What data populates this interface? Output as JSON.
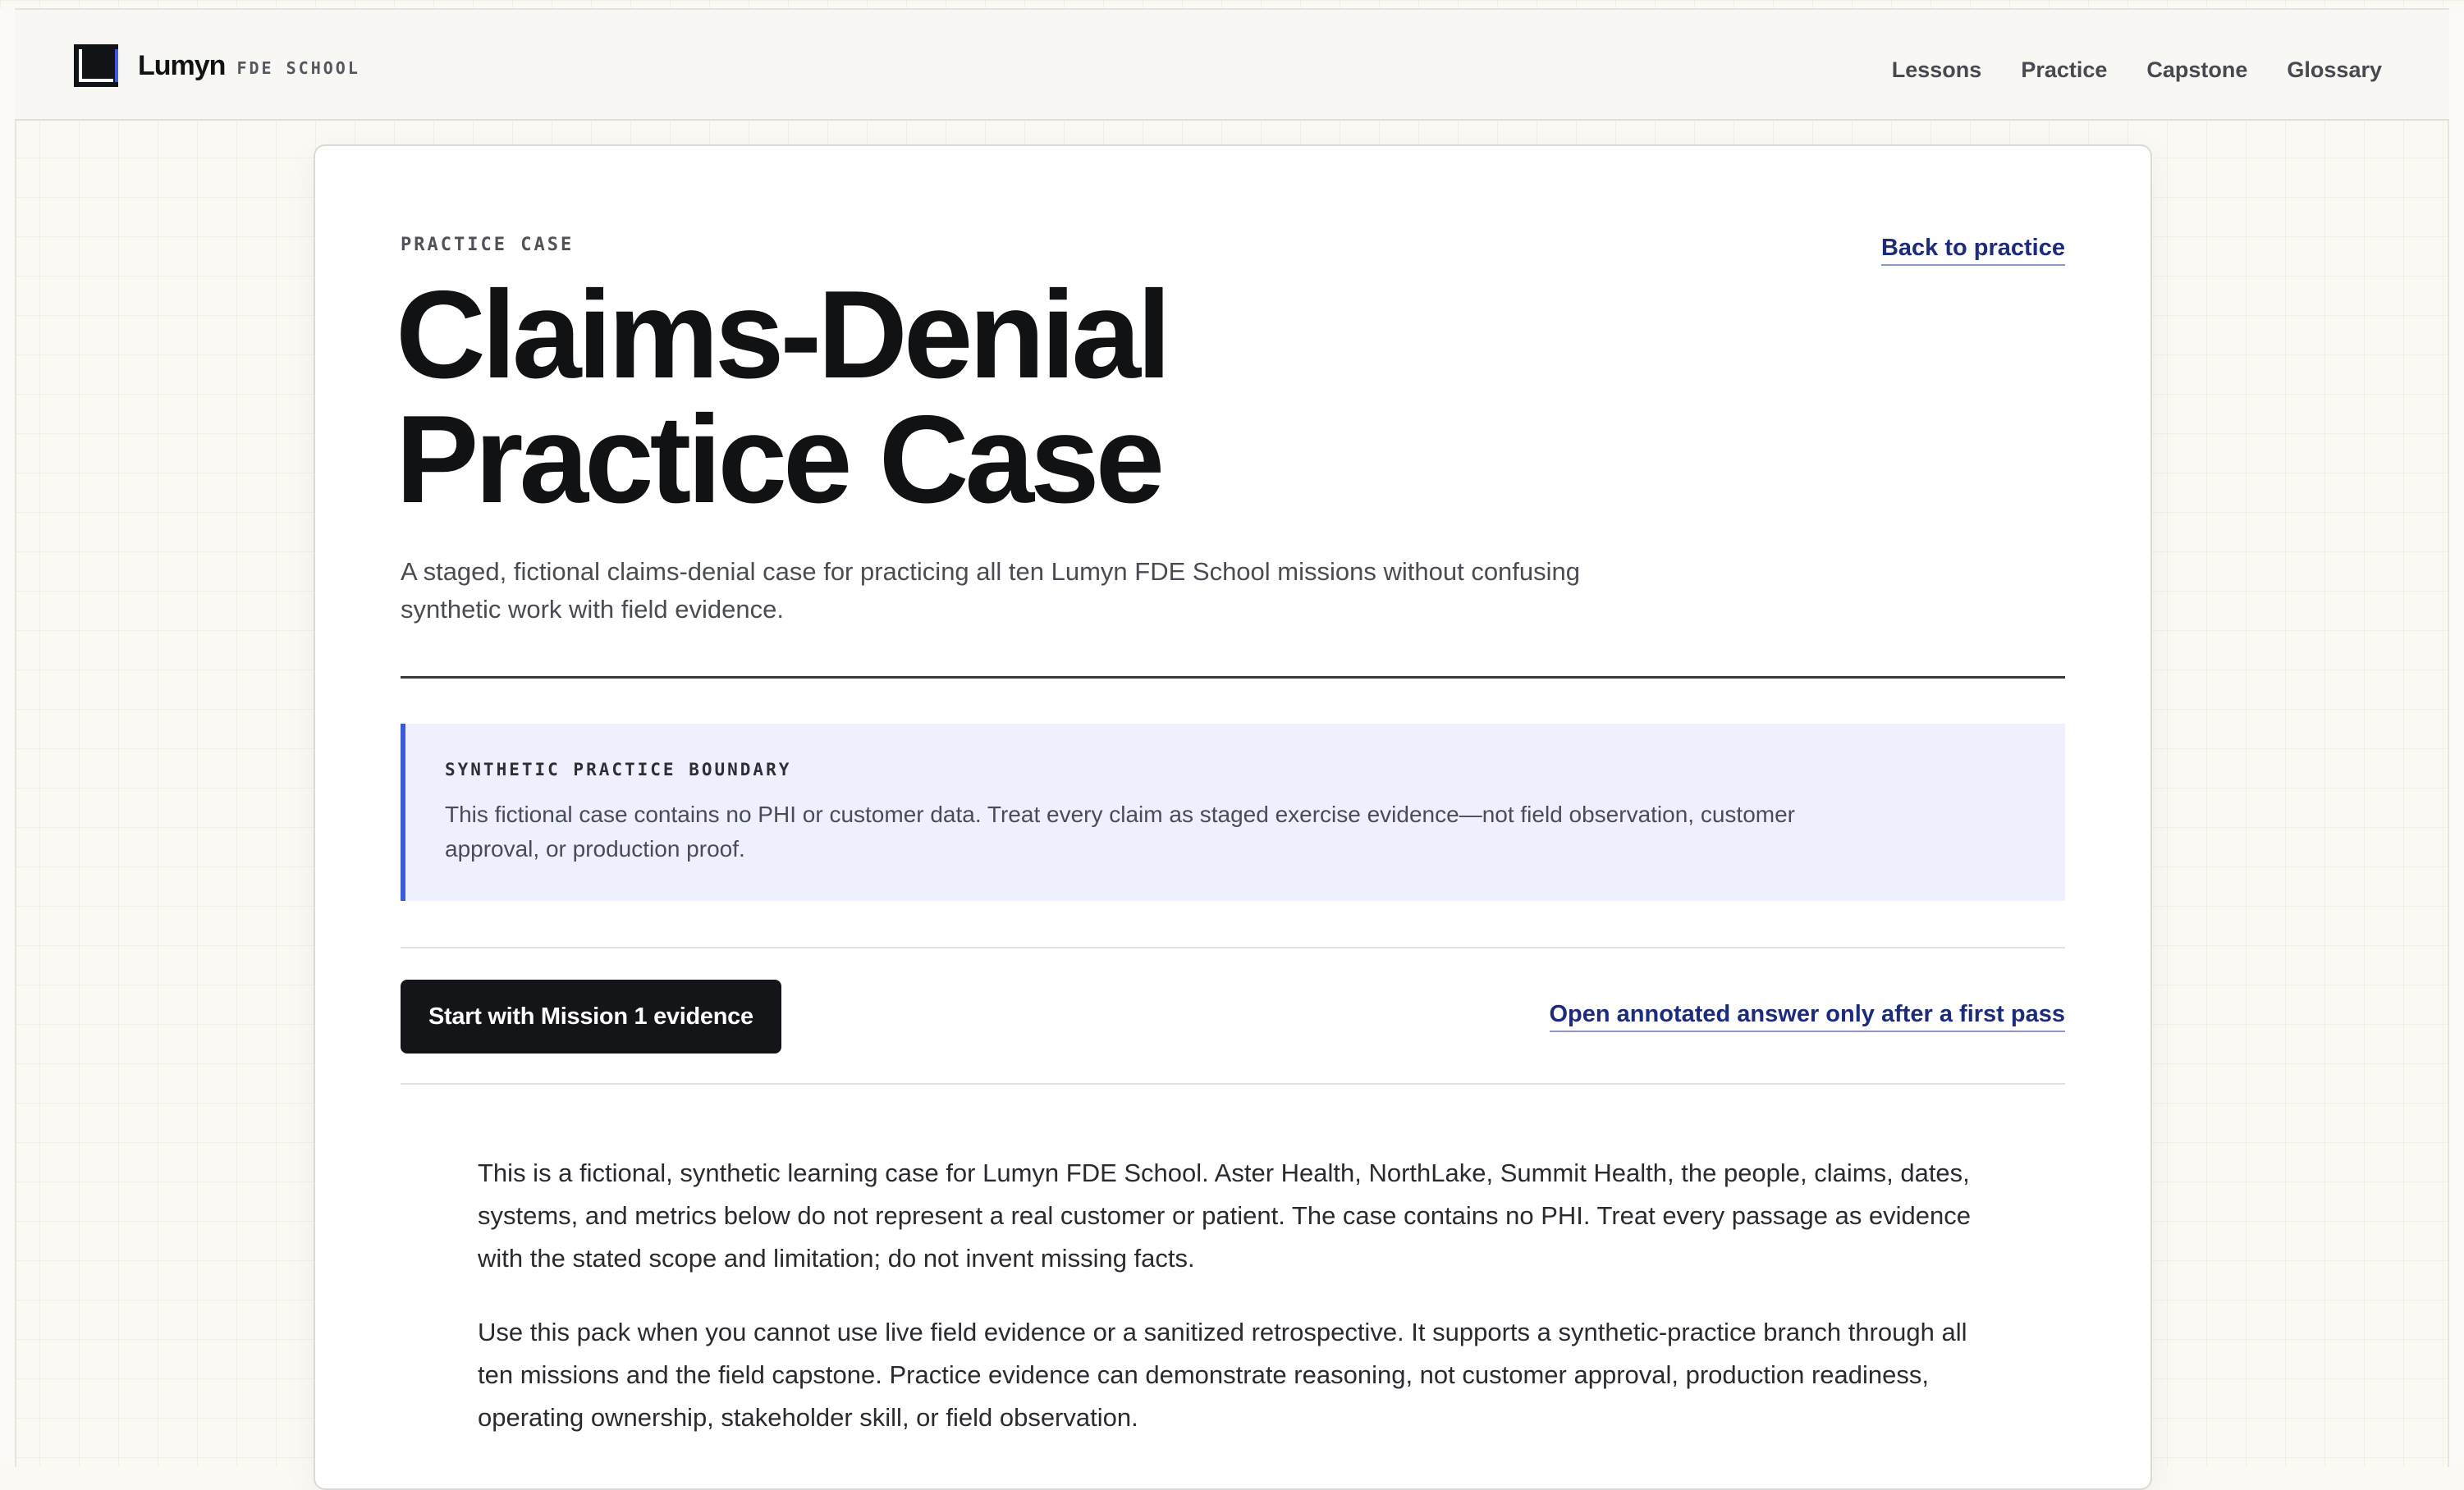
{
  "header": {
    "brand_name": "Lumyn",
    "brand_sub": "FDE SCHOOL",
    "nav": [
      {
        "label": "Lessons"
      },
      {
        "label": "Practice"
      },
      {
        "label": "Capstone"
      },
      {
        "label": "Glossary"
      }
    ]
  },
  "page": {
    "eyebrow": "PRACTICE CASE",
    "back_link": "Back to practice",
    "title_line1": "Claims-Denial",
    "title_line2": "Practice Case",
    "lede": "A staged, fictional claims-denial case for practicing all ten Lumyn FDE School missions without confusing synthetic work with field evidence."
  },
  "boundary": {
    "label": "SYNTHETIC PRACTICE BOUNDARY",
    "text": "This fictional case contains no PHI or customer data. Treat every claim as staged exercise evidence—not field observation, customer approval, or production proof."
  },
  "actions": {
    "primary_label": "Start with Mission 1 evidence",
    "answer_link": "Open annotated answer only after a first pass"
  },
  "body": {
    "paragraphs": [
      "This is a fictional, synthetic learning case for Lumyn FDE School. Aster Health, NorthLake, Summit Health, the people, claims, dates, systems, and metrics below do not represent a real customer or patient. The case contains no PHI. Treat every passage as evidence with the stated scope and limitation; do not invent missing facts.",
      "Use this pack when you cannot use live field evidence or a sanitized retrospective. It supports a synthetic-practice branch through all ten missions and the field capstone. Practice evidence can demonstrate reasoning, not customer approval, production readiness, operating ownership, stakeholder skill, or field observation."
    ]
  },
  "colors": {
    "accent": "#3b5bdb",
    "link": "#1c2c7a",
    "primary_button": "#141519",
    "callout_bg": "#eef1fd"
  },
  "icons": {
    "logo": "lumyn-logo-icon"
  }
}
